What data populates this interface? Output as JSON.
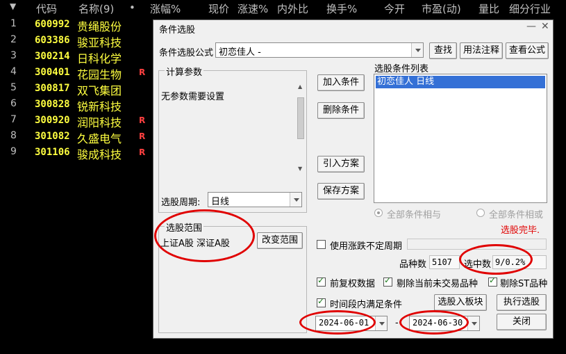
{
  "table": {
    "headers": {
      "sort": "▼",
      "code": "代码",
      "name": "名称(9)",
      "dot": "•",
      "change": "涨幅%",
      "price": "现价",
      "speed": "涨速%",
      "inout": "内外比",
      "turnover": "换手%",
      "open": "今开",
      "pe": "市盈(动)",
      "volratio": "量比",
      "industry": "细分行业"
    },
    "rows": [
      {
        "idx": "1",
        "code": "600992",
        "name": "贵绳股份",
        "flag": ""
      },
      {
        "idx": "2",
        "code": "603386",
        "name": "骏亚科技",
        "flag": ""
      },
      {
        "idx": "3",
        "code": "300214",
        "name": "日科化学",
        "flag": ""
      },
      {
        "idx": "4",
        "code": "300401",
        "name": "花园生物",
        "flag": "R"
      },
      {
        "idx": "5",
        "code": "300817",
        "name": "双飞集团",
        "flag": ""
      },
      {
        "idx": "6",
        "code": "300828",
        "name": "锐新科技",
        "flag": ""
      },
      {
        "idx": "7",
        "code": "300920",
        "name": "润阳科技",
        "flag": "R"
      },
      {
        "idx": "8",
        "code": "301082",
        "name": "久盛电气",
        "flag": "R"
      },
      {
        "idx": "9",
        "code": "301106",
        "name": "骏成科技",
        "flag": "R"
      }
    ]
  },
  "dialog": {
    "title": "条件选股",
    "minimize": "—",
    "close": "✕",
    "formula_label": "条件选股公式",
    "formula_value": "初恋佳人  -",
    "find_button": "查找",
    "usage_button": "用法注释",
    "view_formula_button": "查看公式",
    "params_group": "计算参数",
    "params_text": "无参数需要设置",
    "add_condition": "加入条件",
    "delete_condition": "删除条件",
    "import_scheme": "引入方案",
    "save_scheme": "保存方案",
    "condition_list_label": "选股条件列表",
    "condition_item": "初恋佳人  日线",
    "period_label": "选股周期:",
    "period_value": "日线",
    "all_and": "全部条件相与",
    "all_or": "全部条件相或",
    "status": "选股完毕.",
    "range_group": "选股范围",
    "range_text": "上证A股  深证A股",
    "change_range": "改变范围",
    "use_irregular": "使用涨跌不定周期",
    "count_label": "品种数",
    "count_value": "5107",
    "selected_label": "选中数",
    "selected_value": "9/0.2%",
    "pre_adjust": "前复权数据",
    "exclude_untraded": "剔除当前未交易品种",
    "exclude_st": "剔除ST品种",
    "time_range": "时间段内满足条件",
    "to_block": "选股入板块",
    "execute": "执行选股",
    "date_from": "2024-06-01",
    "date_sep": "-",
    "date_to": "2024-06-30",
    "close_button": "关闭"
  },
  "colors": {
    "accent_red": "#e00000",
    "stock_yellow": "#ffff40",
    "selection_blue": "#3470d6"
  }
}
